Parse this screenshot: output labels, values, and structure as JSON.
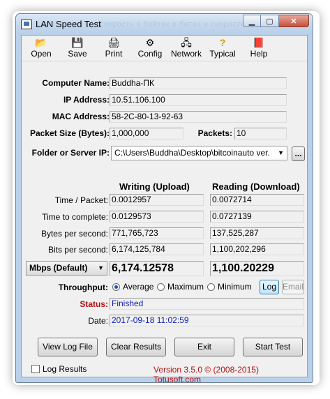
{
  "window": {
    "title": "LAN Speed Test",
    "titlebar_bg_text": "скорость в байтах в битах и скорость"
  },
  "toolbar": [
    {
      "label": "Open",
      "icon": "folder-open-icon",
      "glyph": "📂"
    },
    {
      "label": "Save",
      "icon": "floppy-disk-icon",
      "glyph": "💾"
    },
    {
      "label": "Print",
      "icon": "printer-icon",
      "glyph": "🖨"
    },
    {
      "label": "Config",
      "icon": "config-icon",
      "glyph": "⚙"
    },
    {
      "label": "Network",
      "icon": "network-icon",
      "glyph": "🖧"
    },
    {
      "label": "Typical",
      "icon": "question-icon",
      "glyph": "?"
    },
    {
      "label": "Help",
      "icon": "help-book-icon",
      "glyph": "📕"
    }
  ],
  "info": {
    "computer_name_label": "Computer Name:",
    "computer_name": "Buddha-ПК",
    "ip_label": "IP Address:",
    "ip": "10.51.106.100",
    "mac_label": "MAC Address:",
    "mac": "58-2C-80-13-92-63",
    "packet_size_label": "Packet Size (Bytes):",
    "packet_size": "1,000,000",
    "packets_label": "Packets:",
    "packets": "10",
    "folder_label": "Folder or Server IP:",
    "folder": "C:\\Users\\Buddha\\Desktop\\bitcoinauto ver.",
    "browse_label": "..."
  },
  "results": {
    "writing_header": "Writing (Upload)",
    "reading_header": "Reading (Download)",
    "rows": [
      {
        "label": "Time / Packet:",
        "write": "0.0012957",
        "read": "0.0072714"
      },
      {
        "label": "Time to complete:",
        "write": "0.0129573",
        "read": "0.0727139"
      },
      {
        "label": "Bytes per second:",
        "write": "771,765,723",
        "read": "137,525,287"
      },
      {
        "label": "Bits per second:",
        "write": "6,174,125,784",
        "read": "1,100,202,296"
      }
    ],
    "unit_select": "Mbps (Default)",
    "write_big": "6,174.12578",
    "read_big": "1,100.20229"
  },
  "throughput": {
    "label": "Throughput:",
    "options": [
      "Average",
      "Maximum",
      "Minimum"
    ],
    "selected": "Average",
    "log_button": "Log",
    "email_button": "Email"
  },
  "status": {
    "label": "Status:",
    "value": "Finished",
    "date_label": "Date:",
    "date": "2017-09-18 11:02:59"
  },
  "buttons": {
    "view_log": "View Log File",
    "clear": "Clear Results",
    "exit": "Exit",
    "start": "Start Test"
  },
  "footer": {
    "log_results": "Log Results",
    "version": "Version 3.5.0  © (2008-2015) Totusoft.com"
  },
  "colors": {
    "status_red": "#b01010",
    "value_blue": "#1020b0",
    "frame_blue": "#b9d1ea"
  }
}
